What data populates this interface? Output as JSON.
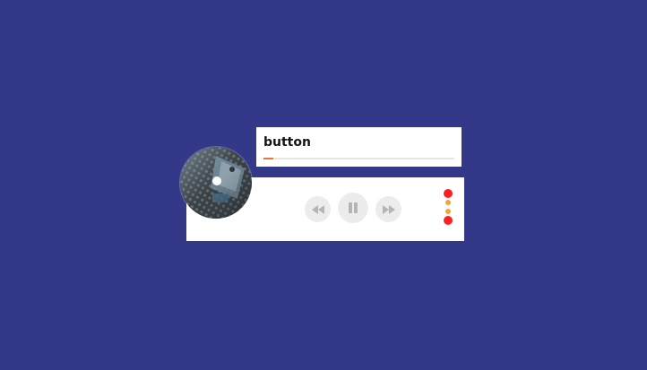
{
  "track": {
    "title": "button",
    "progress": 0.05
  },
  "controls": {
    "rewind_icon": "rewind-icon",
    "pause_icon": "pause-icon",
    "forward_icon": "fast-forward-icon"
  },
  "status_dots": {
    "icon": "more-vertical-icon"
  },
  "colors": {
    "background": "#343889",
    "card": "#ffffff",
    "progress_accent": "#e07a3a",
    "control_bg": "#ececec",
    "control_icon": "#b5b5b5",
    "dot_primary": "#ff1f1f",
    "dot_secondary": "#f4a23a"
  }
}
